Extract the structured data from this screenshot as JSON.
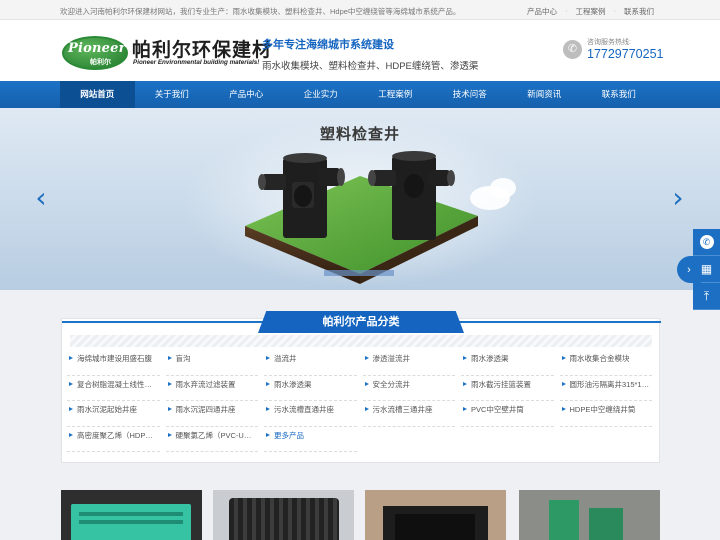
{
  "topbar": {
    "welcome": "欢迎进入河南帕利尔环保建材网站，我们专业生产：雨水收集模块、塑料检查井、Hdpe中空缠绕管等海绵城市系统产品。",
    "links": [
      "产品中心",
      "工程案例",
      "联系我们"
    ]
  },
  "header": {
    "logo_en": "Pioneer",
    "logo_cn_small": "帕利尔",
    "logo_name": "帕利尔环保建材",
    "logo_sub": "Pioneer Environmental  building materials!",
    "slogan_title": "多年专注海绵城市系统建设",
    "slogan_sub": "雨水收集模块、塑料检查井、HDPE缠绕管、渗透渠",
    "hotline_label": "咨询服务热线:",
    "hotline_number": "17729770251"
  },
  "nav": {
    "items": [
      "网站首页",
      "关于我们",
      "产品中心",
      "企业实力",
      "工程案例",
      "技术问答",
      "新闻资讯",
      "联系我们"
    ],
    "active_index": 0
  },
  "banner": {
    "title": "塑料检查井",
    "prev_icon": "chevron-left-icon",
    "next_icon": "chevron-right-icon"
  },
  "side_float": {
    "icons": [
      "phone-icon",
      "qrcode-icon",
      "back-to-top-icon"
    ]
  },
  "categories": {
    "title": "帕利尔产品分类",
    "items": [
      "海绵城市建设用盛石腹",
      "盲沟",
      "溢流井",
      "渗透溢流井",
      "雨水渗透渠",
      "雨水收集合金模块",
      "复合树脂混凝土线性…",
      "雨水弃流过滤装置",
      "雨水渗透渠",
      "安全分流井",
      "雨水截污挂篮装置",
      "圆形油污隔离井315*1…",
      "雨水沉泥起始井座",
      "雨水沉泥四通井座",
      "污水流槽直通井座",
      "污水流槽三通井座",
      "PVC中空壁井筒",
      "HDPE中空缠绕井筒",
      "高密度聚乙烯（HDP…",
      "硬聚氯乙烯（PVC-U…",
      "更多产品"
    ],
    "more_label": "更多产品"
  },
  "colors": {
    "brand_blue": "#1565c0",
    "nav_blue": "#1c72c6",
    "logo_green": "#2b8a35"
  }
}
